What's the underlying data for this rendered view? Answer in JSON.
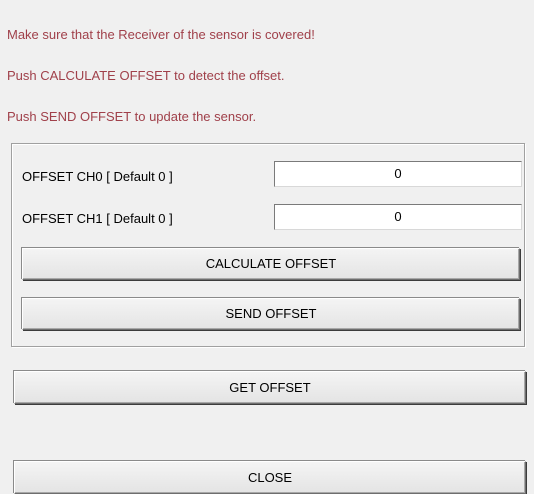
{
  "instructions": [
    "Make sure that the Receiver of the sensor is covered!",
    "Push CALCULATE OFFSET to detect the offset.",
    "Push SEND OFFSET to update the sensor."
  ],
  "offset_panel": {
    "ch0": {
      "label": "OFFSET CH0 [ Default 0 ]",
      "value": "0"
    },
    "ch1": {
      "label": "OFFSET CH1 [ Default 0 ]",
      "value": "0"
    },
    "calculate_label": "CALCULATE OFFSET",
    "send_label": "SEND OFFSET"
  },
  "get_offset_label": "GET OFFSET",
  "close_label": "CLOSE",
  "colors": {
    "instruction_text": "#a0404a",
    "background": "#f0f0f0"
  }
}
